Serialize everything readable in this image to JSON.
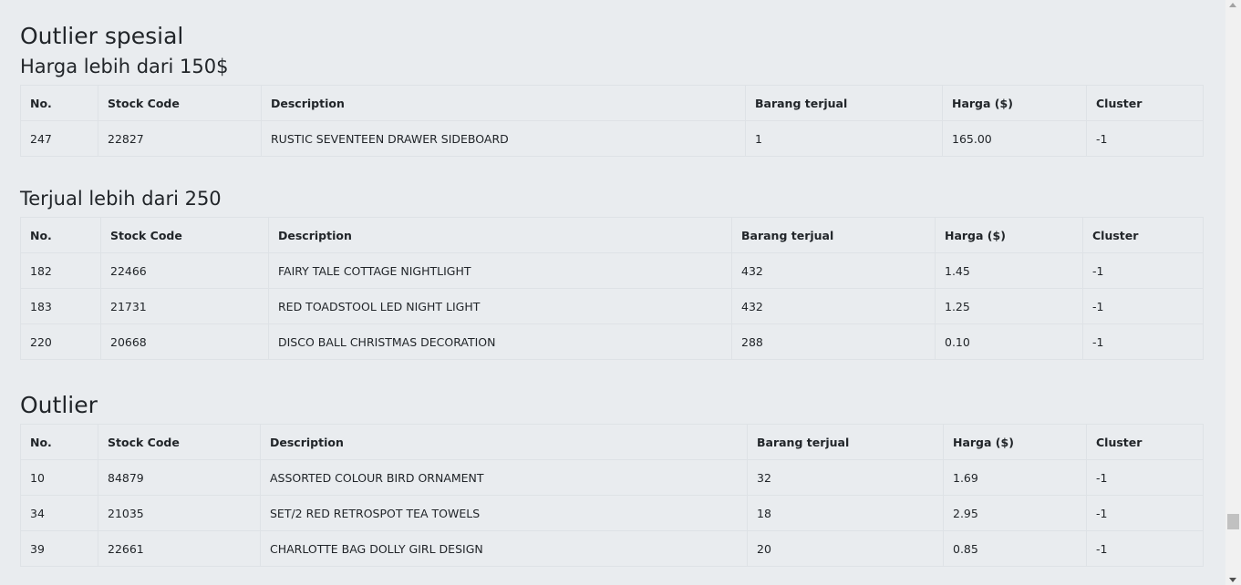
{
  "sections": {
    "outlier_spesial": "Outlier spesial",
    "harga_lebih": "Harga lebih dari 150$",
    "terjual_lebih": "Terjual lebih dari 250",
    "outlier": "Outlier"
  },
  "columns": [
    "No.",
    "Stock Code",
    "Description",
    "Barang terjual",
    "Harga ($)",
    "Cluster"
  ],
  "table_harga": [
    [
      "247",
      "22827",
      "RUSTIC SEVENTEEN DRAWER SIDEBOARD",
      "1",
      "165.00",
      "-1"
    ]
  ],
  "table_terjual": [
    [
      "182",
      "22466",
      "FAIRY TALE COTTAGE NIGHTLIGHT",
      "432",
      "1.45",
      "-1"
    ],
    [
      "183",
      "21731",
      "RED TOADSTOOL LED NIGHT LIGHT",
      "432",
      "1.25",
      "-1"
    ],
    [
      "220",
      "20668",
      "DISCO BALL CHRISTMAS DECORATION",
      "288",
      "0.10",
      "-1"
    ]
  ],
  "table_outlier": [
    [
      "10",
      "84879",
      "ASSORTED COLOUR BIRD ORNAMENT",
      "32",
      "1.69",
      "-1"
    ],
    [
      "34",
      "21035",
      "SET/2 RED RETROSPOT TEA TOWELS",
      "18",
      "2.95",
      "-1"
    ],
    [
      "39",
      "22661",
      "CHARLOTTE BAG DOLLY GIRL DESIGN",
      "20",
      "0.85",
      "-1"
    ]
  ]
}
